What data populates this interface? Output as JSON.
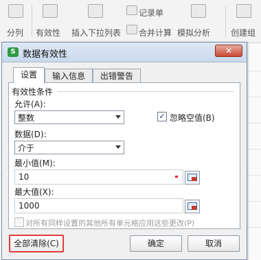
{
  "ribbon": {
    "items": [
      {
        "label": "分列",
        "icon": "split-columns-icon"
      },
      {
        "label": "有效性",
        "icon": "validation-icon"
      },
      {
        "label": "插入下拉列表",
        "icon": "dropdown-list-icon"
      },
      {
        "label": "记录单",
        "icon": "record-form-icon"
      },
      {
        "label": "合并计算",
        "icon": "consolidate-icon"
      },
      {
        "label": "模拟分析",
        "icon": "what-if-icon"
      },
      {
        "label": "创建组",
        "icon": "create-group-icon"
      }
    ]
  },
  "dialog": {
    "title": "数据有效性",
    "close_symbol": "✕",
    "tabs": [
      "设置",
      "输入信息",
      "出错警告"
    ],
    "section_title": "有效性条件",
    "allow_label": "允许(A):",
    "allow_value": "整数",
    "ignore_blank_label": "忽略空值(B)",
    "ignore_blank_checked": "✓",
    "data_label": "数据(D):",
    "data_value": "介于",
    "min_label": "最小值(M):",
    "min_value": "10",
    "max_label": "最大值(X):",
    "max_value": "1000",
    "apply_all_label": "对所有同样设置的其他所有单元格应用这些更改(P)",
    "clear_all_label": "全部清除(C)",
    "ok_label": "确定",
    "cancel_label": "取消"
  },
  "colors": {
    "highlight_border": "#e03a3a",
    "title_bar": "#c9d9ec",
    "close_button": "#c74a34"
  }
}
